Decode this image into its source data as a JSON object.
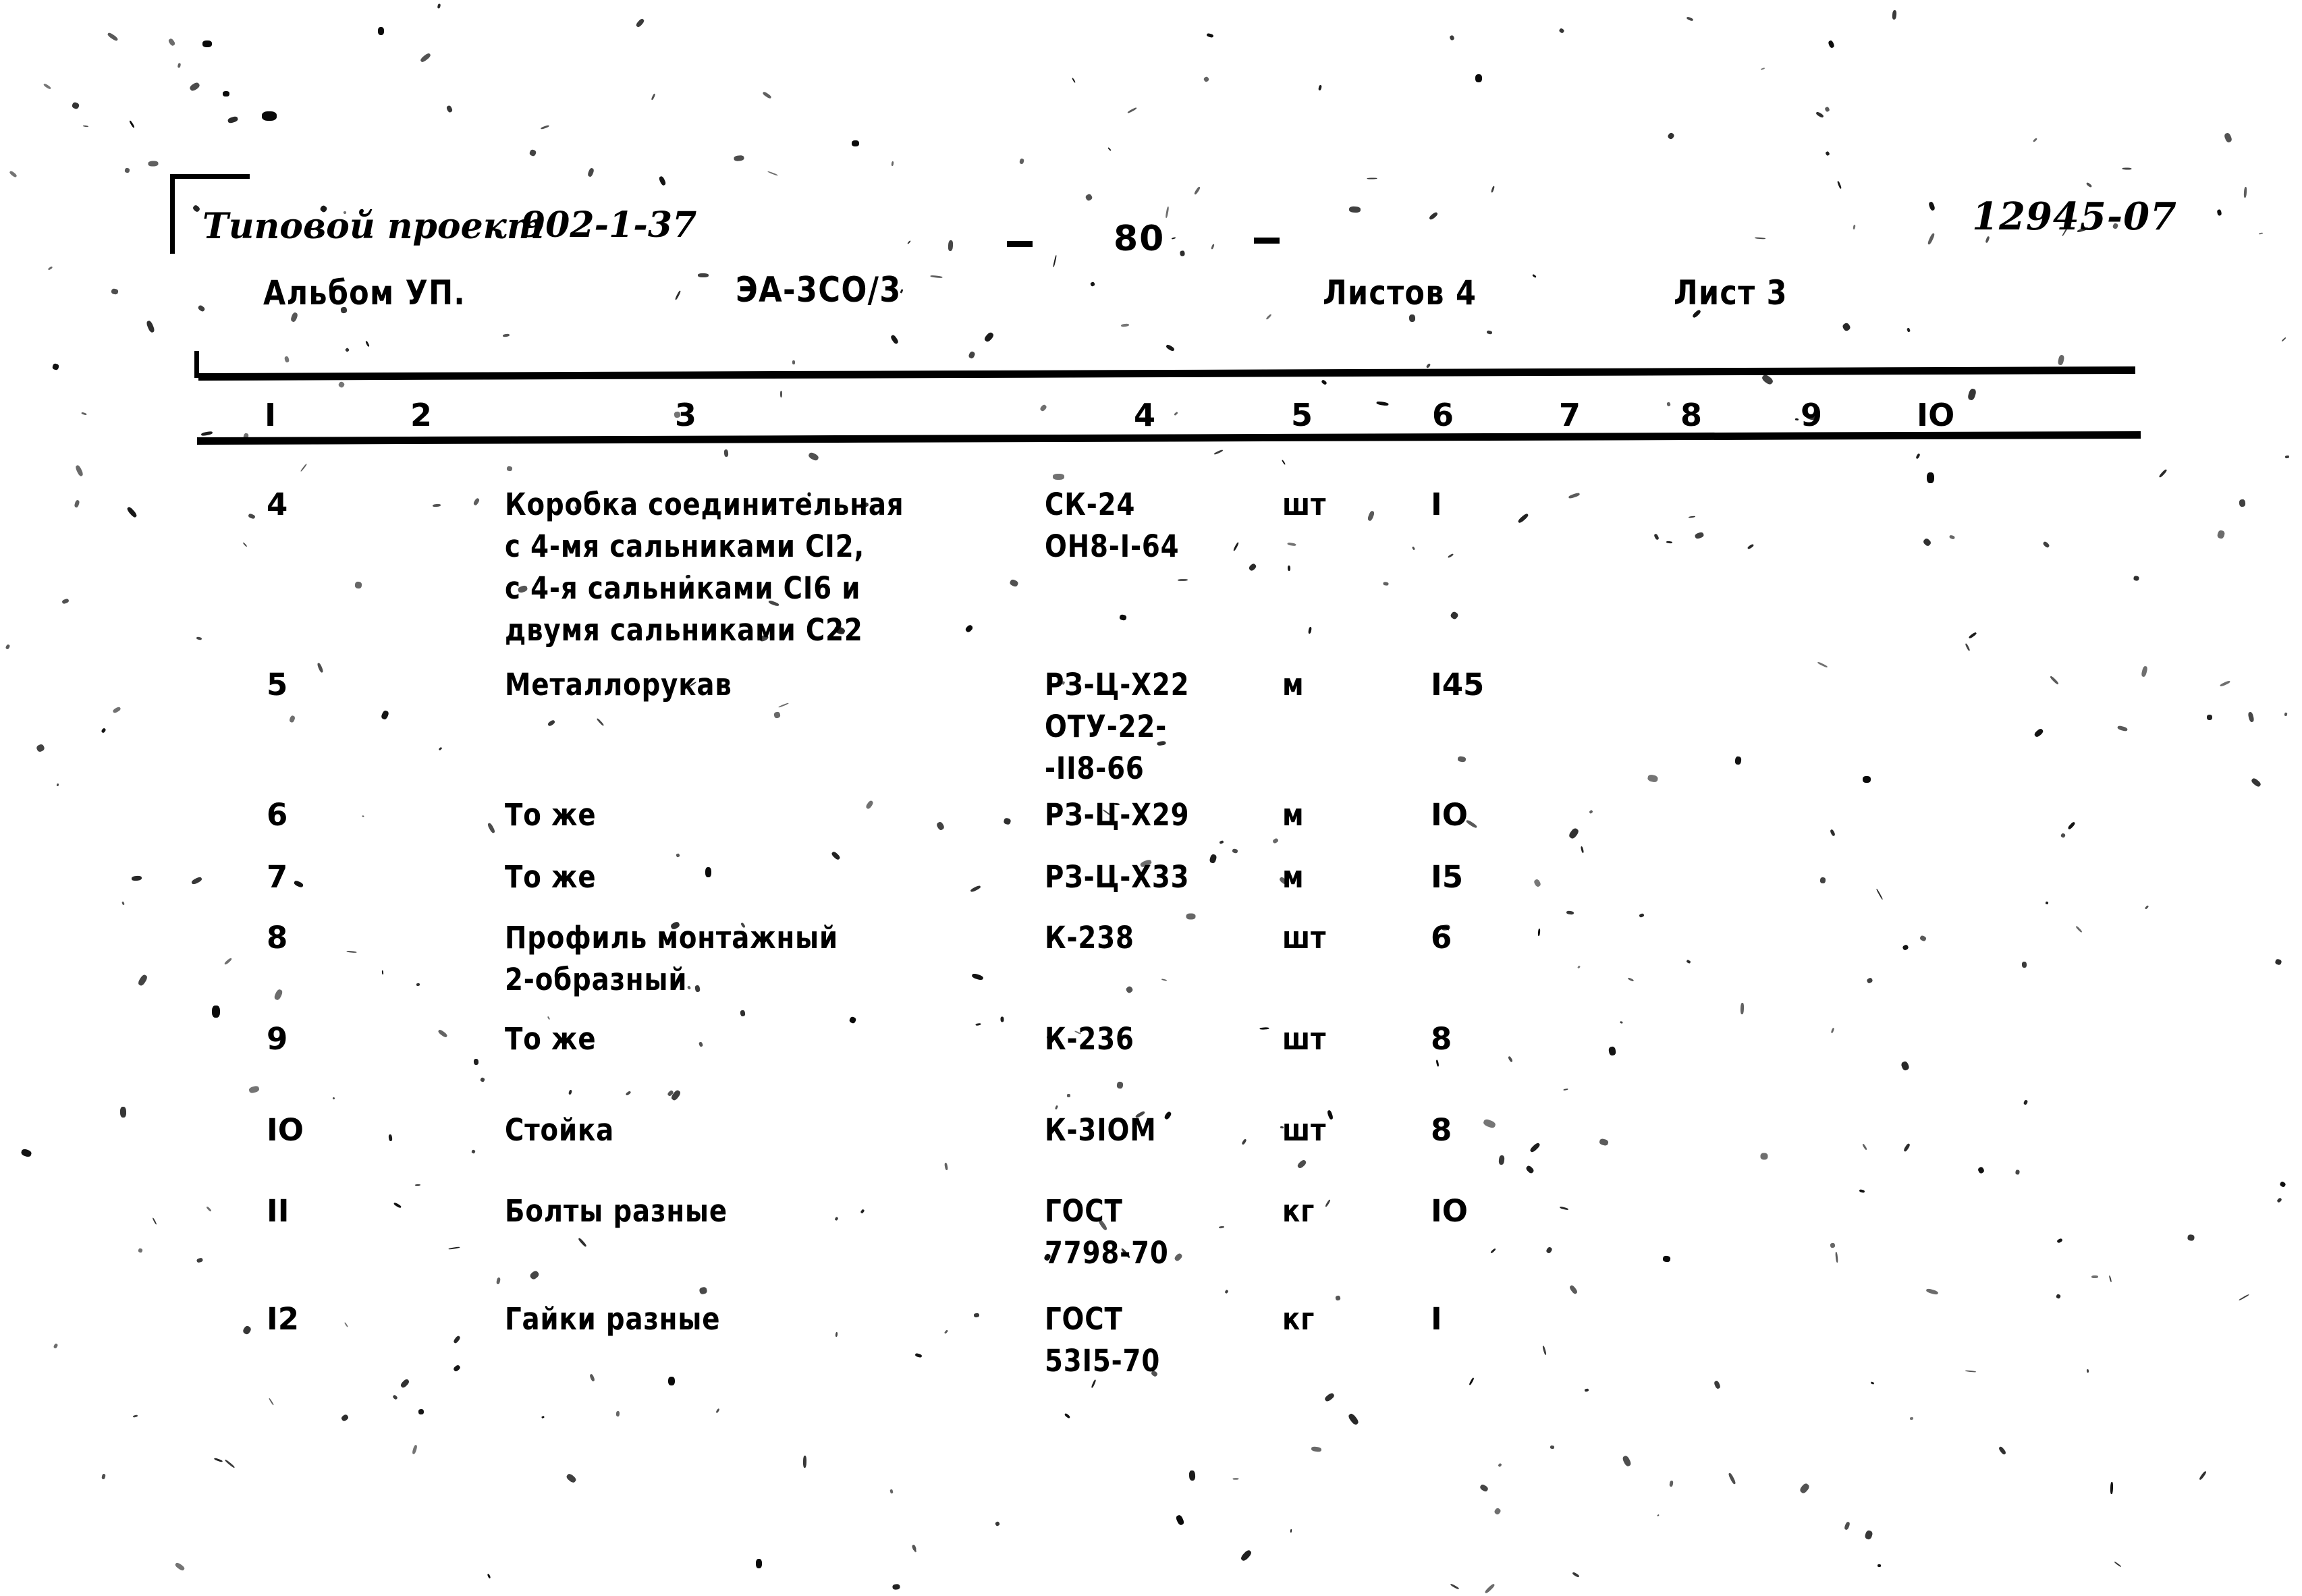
{
  "document": {
    "page_number": "80",
    "archive_code": "12945-07"
  },
  "header": {
    "project_label": "Типовой проект",
    "project_number": "902-1-37",
    "album_label": "Альбом УП.",
    "album_code": "ЭА-3СО/3",
    "sheets_total_label": "Листов 4",
    "sheet_label": "Лист 3"
  },
  "table": {
    "column_numbers": [
      "I",
      "2",
      "3",
      "4",
      "5",
      "6",
      "7",
      "8",
      "9",
      "IO"
    ],
    "rows": [
      {
        "pos": "4",
        "name": [
          "Коробка соединительная",
          "с 4-мя сальниками СI2,",
          "с 4-я сальниками СI6 и",
          "двумя сальниками С22"
        ],
        "spec": [
          "СК-24",
          "ОН8-I-64"
        ],
        "unit": "шт",
        "qty": "I"
      },
      {
        "pos": "5",
        "name": [
          "Металлорукав"
        ],
        "spec": [
          "РЗ-Ц-Х22",
          "ОТУ-22-",
          "-II8-66"
        ],
        "unit": "м",
        "qty": "I45"
      },
      {
        "pos": "6",
        "name": [
          "То же"
        ],
        "spec": [
          "РЗ-Ц-Х29"
        ],
        "unit": "м",
        "qty": "IO"
      },
      {
        "pos": "7",
        "name": [
          "То же"
        ],
        "spec": [
          "РЗ-Ц-Х33"
        ],
        "unit": "м",
        "qty": "I5"
      },
      {
        "pos": "8",
        "name": [
          "Профиль монтажный",
          "2-образный"
        ],
        "spec": [
          "К-238"
        ],
        "unit": "шт",
        "qty": "6"
      },
      {
        "pos": "9",
        "name": [
          "То же"
        ],
        "spec": [
          "К-236"
        ],
        "unit": "шт",
        "qty": "8"
      },
      {
        "pos": "IO",
        "name": [
          "Стойка"
        ],
        "spec": [
          "К-3IOМ"
        ],
        "unit": "шт",
        "qty": "8"
      },
      {
        "pos": "II",
        "name": [
          "Болты разные"
        ],
        "spec": [
          "ГОСТ",
          "7798-70"
        ],
        "unit": "кг",
        "qty": "IO"
      },
      {
        "pos": "I2",
        "name": [
          "Гайки разные"
        ],
        "spec": [
          "ГОСТ",
          "53I5-70"
        ],
        "unit": "кг",
        "qty": "I"
      }
    ]
  }
}
